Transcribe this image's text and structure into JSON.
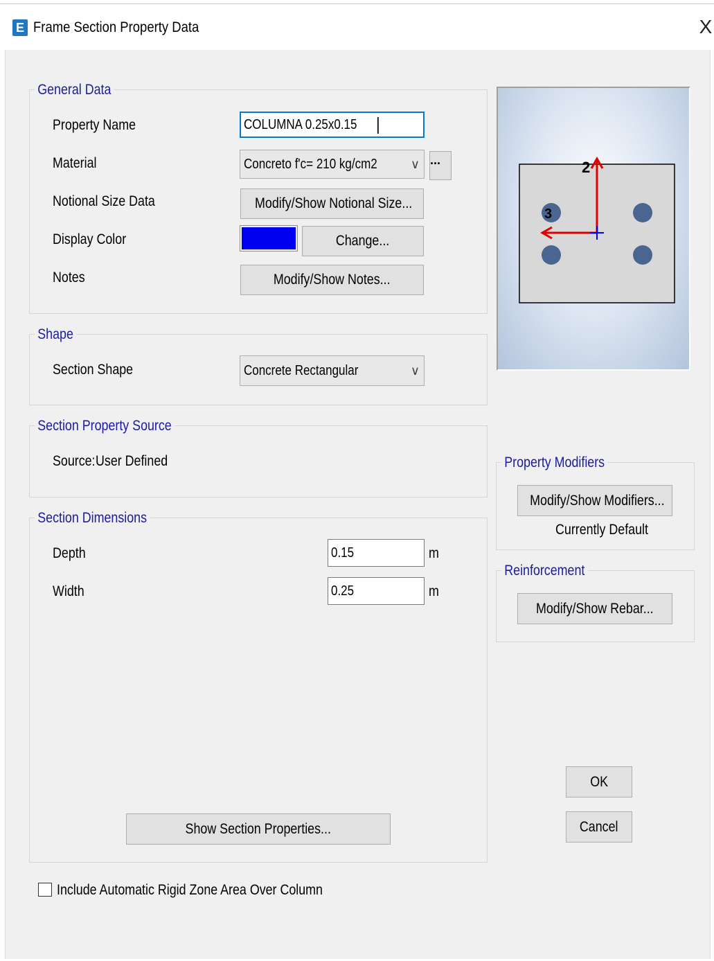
{
  "window": {
    "title": "Frame Section Property Data",
    "app_icon_letter": "E",
    "close_glyph": "X"
  },
  "general_data": {
    "title": "General Data",
    "property_name_label": "Property Name",
    "property_name_value": "COLUMNA 0.25x0.15",
    "material_label": "Material",
    "material_value": "Concreto f'c= 210 kg/cm2",
    "material_more_label": "...",
    "notional_label": "Notional Size Data",
    "notional_button": "Modify/Show Notional Size...",
    "display_color_label": "Display Color",
    "display_color_value": "#0000f0",
    "change_button": "Change...",
    "notes_label": "Notes",
    "notes_button": "Modify/Show Notes..."
  },
  "shape": {
    "title": "Shape",
    "section_shape_label": "Section Shape",
    "section_shape_value": "Concrete Rectangular"
  },
  "source": {
    "title": "Section Property Source",
    "source_label": "Source:",
    "source_value": "User Defined"
  },
  "dimensions": {
    "title": "Section Dimensions",
    "depth_label": "Depth",
    "depth_value": "0.15",
    "depth_unit": "m",
    "width_label": "Width",
    "width_value": "0.25",
    "width_unit": "m",
    "show_properties_button": "Show Section Properties..."
  },
  "preview": {
    "axis_2_label": "2",
    "axis_3_label": "3"
  },
  "property_modifiers": {
    "title": "Property Modifiers",
    "button": "Modify/Show Modifiers...",
    "status": "Currently Default"
  },
  "reinforcement": {
    "title": "Reinforcement",
    "button": "Modify/Show Rebar..."
  },
  "ok_button": "OK",
  "cancel_button": "Cancel",
  "rigid_zone_checkbox": {
    "label": "Include Automatic Rigid Zone Area Over Column",
    "checked": false
  },
  "colors": {
    "group_title": "#1a1aa6",
    "axis_red": "#e00000",
    "axis_blue": "#0000ff",
    "rebar": "#4a6590"
  }
}
